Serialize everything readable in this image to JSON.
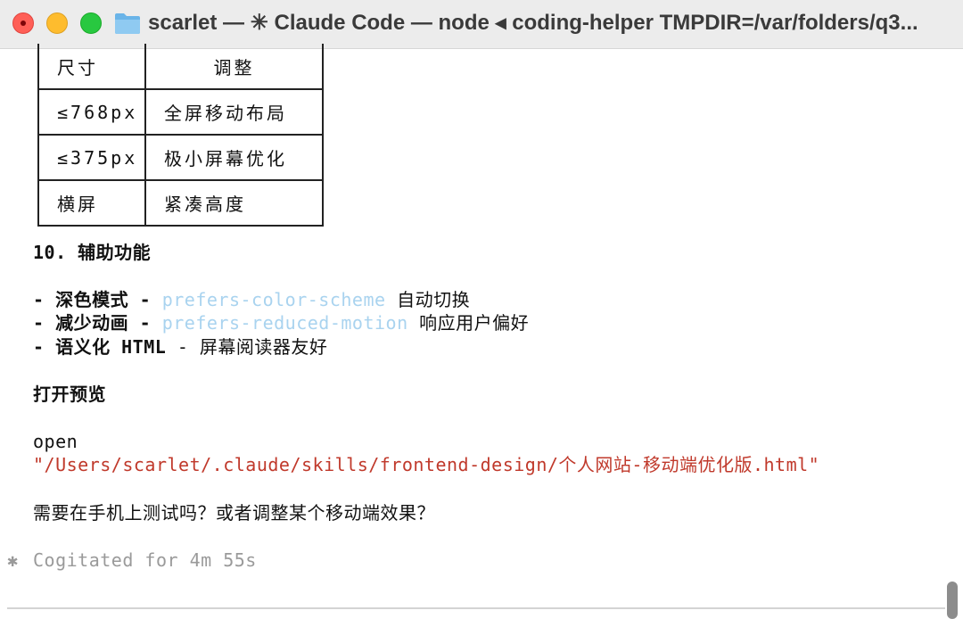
{
  "window": {
    "title": "scarlet — ✳ Claude Code — node ◂ coding-helper TMPDIR=/var/folders/q3..."
  },
  "table": {
    "headers": [
      "尺寸",
      "调整"
    ],
    "rows": [
      [
        "≤768px",
        "全屏移动布局"
      ],
      [
        "≤375px",
        "极小屏幕优化"
      ],
      [
        "横屏",
        "紧凑高度"
      ]
    ]
  },
  "section10": {
    "heading": "10. 辅助功能",
    "items": [
      {
        "prefix": "- 深色模式 - ",
        "code": "prefers-color-scheme",
        "suffix": " 自动切换"
      },
      {
        "prefix": "- 减少动画 - ",
        "code": "prefers-reduced-motion",
        "suffix": " 响应用户偏好"
      },
      {
        "prefix": "- 语义化 HTML",
        "suffix": " - 屏幕阅读器友好"
      }
    ]
  },
  "preview": {
    "heading": "打开预览",
    "command": "open",
    "path": "\"/Users/scarlet/.claude/skills/frontend-design/个人网站-移动端优化版.html\""
  },
  "question": "需要在手机上测试吗？或者调整某个移动端效果？",
  "status": {
    "icon": "✱",
    "text": "Cogitated for 4m 55s"
  },
  "colors": {
    "code": "#a9d3ef",
    "path": "#c0392b",
    "dim": "#9a9a9a"
  }
}
